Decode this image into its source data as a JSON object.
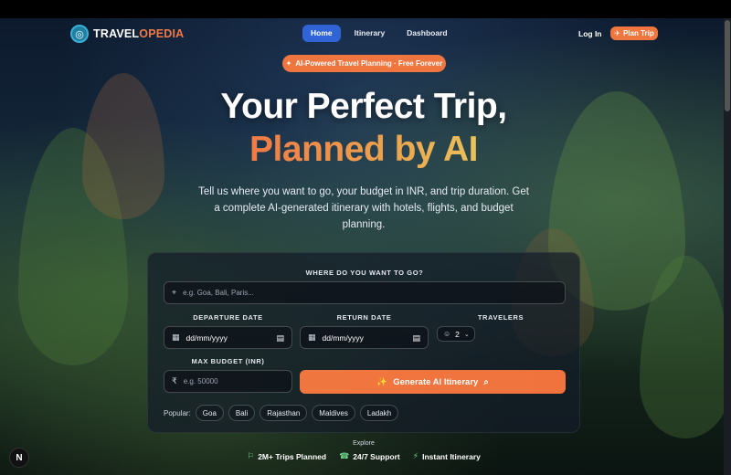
{
  "brand": {
    "name_part1": "TRAVEL",
    "name_part2": "OPEDIA"
  },
  "nav": {
    "links": [
      {
        "label": "Home",
        "active": true
      },
      {
        "label": "Itinerary",
        "active": false
      },
      {
        "label": "Dashboard",
        "active": false
      }
    ],
    "login_label": "Log In",
    "plan_label": "Plan Trip"
  },
  "hero": {
    "pill": "AI-Powered Travel Planning · Free Forever",
    "title_line1": "Your Perfect Trip,",
    "title_line2": "Planned by AI",
    "subtitle": "Tell us where you want to go, your budget in INR, and trip duration. Get a complete AI-generated itinerary with hotels, flights, and budget planning."
  },
  "form": {
    "destination_label": "WHERE DO YOU WANT TO GO?",
    "destination_placeholder": "e.g. Goa, Bali, Paris...",
    "departure_label": "DEPARTURE DATE",
    "departure_value": "dd/mm/yyyy",
    "return_label": "RETURN DATE",
    "return_value": "dd/mm/yyyy",
    "travelers_label": "TRAVELERS",
    "travelers_value": "2",
    "budget_label": "MAX BUDGET (INR)",
    "budget_currency": "₹",
    "budget_placeholder": "e.g. 50000",
    "generate_label": "Generate AI Itinerary",
    "popular_label": "Popular:",
    "popular": [
      "Goa",
      "Bali",
      "Rajasthan",
      "Maldives",
      "Ladakh"
    ]
  },
  "footer": {
    "explore": "Explore",
    "stats": [
      "2M+ Trips Planned",
      "24/7 Support",
      "Instant Itinerary"
    ]
  },
  "colors": {
    "accent": "#f0763f",
    "nav_active": "#2f63d6",
    "stat_icon": "#6fd98c"
  }
}
